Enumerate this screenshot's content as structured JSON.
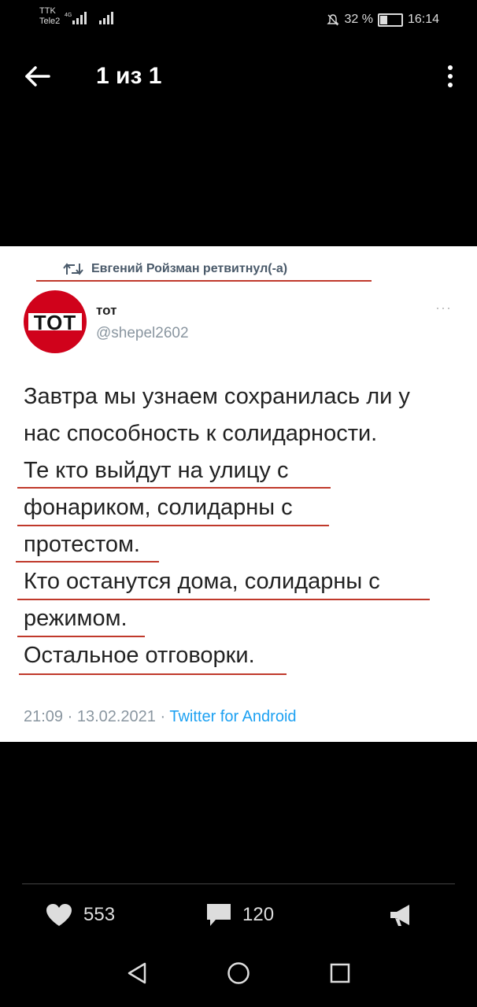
{
  "status_bar": {
    "carrier_line1": "TTK",
    "carrier_line2": "Tele2",
    "network": "4G",
    "battery": "32 %",
    "time": "16:14"
  },
  "header": {
    "counter": "1 из 1"
  },
  "tweet": {
    "retweet_label": "Евгений Ройзман ретвитнул(-а)",
    "author_name": "тот",
    "author_handle": "@shepel2602",
    "avatar_text": "TOT",
    "lines": [
      "Завтра мы узнаем сохранилась ли у",
      "нас способность к солидарности.",
      "Те кто выйдут на улицу с",
      "фонариком, солидарны с",
      "протестом.",
      "Кто останутся дома, солидарны с",
      "режимом.",
      "Остальное отговорки."
    ],
    "timestamp": "21:09 · 13.02.2021 · ",
    "source": "Twitter for Android",
    "more_icon": "···"
  },
  "actions": {
    "likes": "553",
    "comments": "120"
  },
  "colors": {
    "background": "#000000",
    "tweet_bg": "#ffffff",
    "underline": "#c0392b",
    "link": "#1da1f2"
  }
}
